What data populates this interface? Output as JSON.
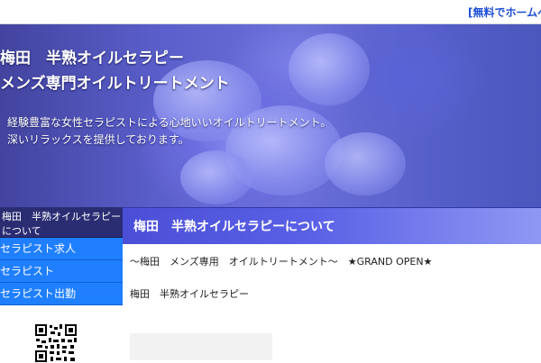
{
  "topbar": {
    "link": "[無料でホームペ"
  },
  "hero": {
    "title_line1": "梅田　半熟オイルセラピー",
    "title_line2": "メンズ専門オイルトリートメント",
    "desc_line1": "経験豊富な女性セラピストによる心地いいオイルトリートメント。",
    "desc_line2": "深いリラックスを提供しております。"
  },
  "sidebar": {
    "title": "梅田　半熟オイルセラピーについて",
    "items": [
      {
        "label": "セラピスト求人"
      },
      {
        "label": "セラピスト"
      },
      {
        "label": "セラピスト出勤"
      }
    ],
    "qr_icon": "qr-code-icon"
  },
  "main": {
    "header": "梅田　半熟オイルセラピーについて",
    "line1": "～梅田　メンズ専用　オイルトリートメント～　★GRAND OPEN★",
    "line2": "梅田　半熟オイルセラピー"
  },
  "colors": {
    "accent_blue": "#1f7fff",
    "sidebar_title_bg": "#2b2d73",
    "header_gradient_start": "#4b4fd7",
    "link": "#1d4fd6"
  }
}
